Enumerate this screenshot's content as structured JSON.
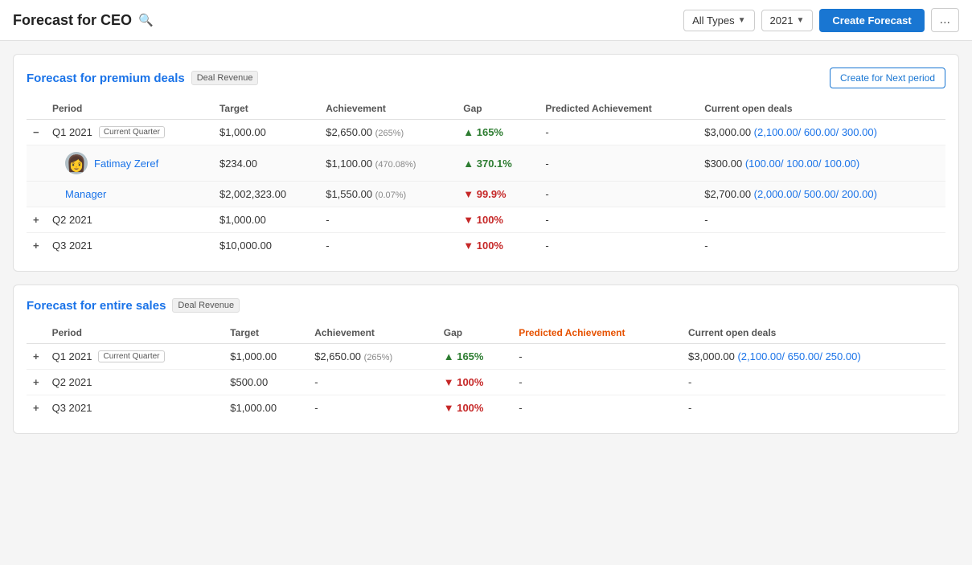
{
  "header": {
    "title": "Forecast for CEO",
    "search_icon": "🔍",
    "all_types_label": "All Types",
    "year_label": "2021",
    "create_forecast_label": "Create Forecast",
    "more_label": "..."
  },
  "sections": [
    {
      "id": "premium",
      "title": "Forecast for premium deals",
      "badge": "Deal Revenue",
      "create_next_period_label": "Create for Next period",
      "columns": [
        "Period",
        "Target",
        "Achievement",
        "Gap",
        "Predicted Achievement",
        "Current open deals"
      ],
      "rows": [
        {
          "type": "parent",
          "expandable": true,
          "expanded": true,
          "expand_icon": "minus",
          "period": "Q1 2021",
          "current_quarter": true,
          "current_quarter_label": "Current Quarter",
          "target": "$1,000.00",
          "achievement": "$2,650.00",
          "achievement_pct": "(265%)",
          "gap_arrow": "up",
          "gap": "165%",
          "gap_color": "green",
          "predicted_achievement": "-",
          "open_deals": "$3,000.00",
          "open_deals_detail": "(2,100.00/ 600.00/ 300.00)"
        },
        {
          "type": "sub",
          "expandable": false,
          "has_avatar": true,
          "avatar_emoji": "👩",
          "period": "Fatimay Zeref",
          "period_link": true,
          "target": "$234.00",
          "achievement": "$1,100.00",
          "achievement_pct": "(470.08%)",
          "gap_arrow": "up",
          "gap": "370.1%",
          "gap_color": "green",
          "predicted_achievement": "-",
          "open_deals": "$300.00",
          "open_deals_detail": "(100.00/ 100.00/ 100.00)"
        },
        {
          "type": "sub",
          "expandable": false,
          "has_avatar": false,
          "period": "Manager",
          "period_link": true,
          "target": "$2,002,323.00",
          "achievement": "$1,550.00",
          "achievement_pct": "(0.07%)",
          "gap_arrow": "down",
          "gap": "99.9%",
          "gap_color": "red",
          "predicted_achievement": "-",
          "open_deals": "$2,700.00",
          "open_deals_detail": "(2,000.00/ 500.00/ 200.00)"
        },
        {
          "type": "parent",
          "expandable": true,
          "expanded": false,
          "expand_icon": "plus",
          "period": "Q2 2021",
          "current_quarter": false,
          "target": "$1,000.00",
          "achievement": "-",
          "achievement_pct": "",
          "gap_arrow": "down",
          "gap": "100%",
          "gap_color": "red",
          "predicted_achievement": "-",
          "open_deals": "-"
        },
        {
          "type": "parent",
          "expandable": true,
          "expanded": false,
          "expand_icon": "plus",
          "period": "Q3 2021",
          "current_quarter": false,
          "target": "$10,000.00",
          "achievement": "-",
          "achievement_pct": "",
          "gap_arrow": "down",
          "gap": "100%",
          "gap_color": "red",
          "predicted_achievement": "-",
          "open_deals": "-"
        }
      ]
    },
    {
      "id": "entire",
      "title": "Forecast for entire sales",
      "badge": "Deal Revenue",
      "create_next_period_label": "",
      "columns": [
        "Period",
        "Target",
        "Achievement",
        "Gap",
        "Predicted Achievement",
        "Current open deals"
      ],
      "rows": [
        {
          "type": "parent",
          "expandable": true,
          "expanded": false,
          "expand_icon": "plus",
          "period": "Q1 2021",
          "current_quarter": true,
          "current_quarter_label": "Current Quarter",
          "target": "$1,000.00",
          "achievement": "$2,650.00",
          "achievement_pct": "(265%)",
          "gap_arrow": "up",
          "gap": "165%",
          "gap_color": "green",
          "predicted_achievement": "-",
          "predicted_color": "orange",
          "open_deals": "$3,000.00",
          "open_deals_detail": "(2,100.00/ 650.00/ 250.00)"
        },
        {
          "type": "parent",
          "expandable": true,
          "expanded": false,
          "expand_icon": "plus",
          "period": "Q2 2021",
          "current_quarter": false,
          "target": "$500.00",
          "achievement": "-",
          "achievement_pct": "",
          "gap_arrow": "down",
          "gap": "100%",
          "gap_color": "red",
          "predicted_achievement": "-",
          "open_deals": "-"
        },
        {
          "type": "parent",
          "expandable": true,
          "expanded": false,
          "expand_icon": "plus",
          "period": "Q3 2021",
          "current_quarter": false,
          "target": "$1,000.00",
          "achievement": "-",
          "achievement_pct": "",
          "gap_arrow": "down",
          "gap": "100%",
          "gap_color": "red",
          "predicted_achievement": "-",
          "open_deals": "-"
        }
      ]
    }
  ]
}
